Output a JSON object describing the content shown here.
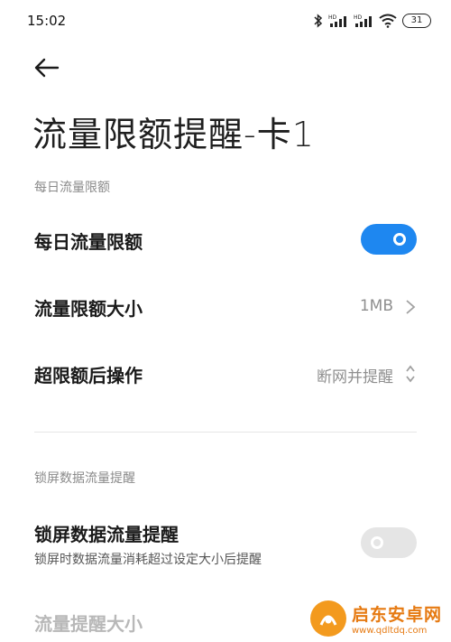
{
  "status_bar": {
    "time": "15:02",
    "battery": "31",
    "icons": [
      "bluetooth-icon",
      "signal-hd-icon",
      "signal-hd-icon",
      "wifi-icon",
      "battery-icon"
    ]
  },
  "header": {
    "back_icon": "arrow-left-icon",
    "title": "流量限额提醒-卡1"
  },
  "daily_section": {
    "header": "每日流量限额",
    "toggle_label": "每日流量限额",
    "toggle_on": true,
    "limit_label": "流量限额大小",
    "limit_value": "1MB",
    "action_label": "超限额后操作",
    "action_value": "断网并提醒"
  },
  "lockscreen_section": {
    "header": "锁屏数据流量提醒",
    "toggle_label": "锁屏数据流量提醒",
    "toggle_sub": "锁屏时数据流量消耗超过设定大小后提醒",
    "toggle_on": false,
    "size_label": "流量提醒大小"
  },
  "watermark": {
    "name": "启东安卓网",
    "url": "www.qdltdq.com"
  },
  "colors": {
    "accent": "#1e87f0",
    "watermark": "#f39a1e"
  }
}
